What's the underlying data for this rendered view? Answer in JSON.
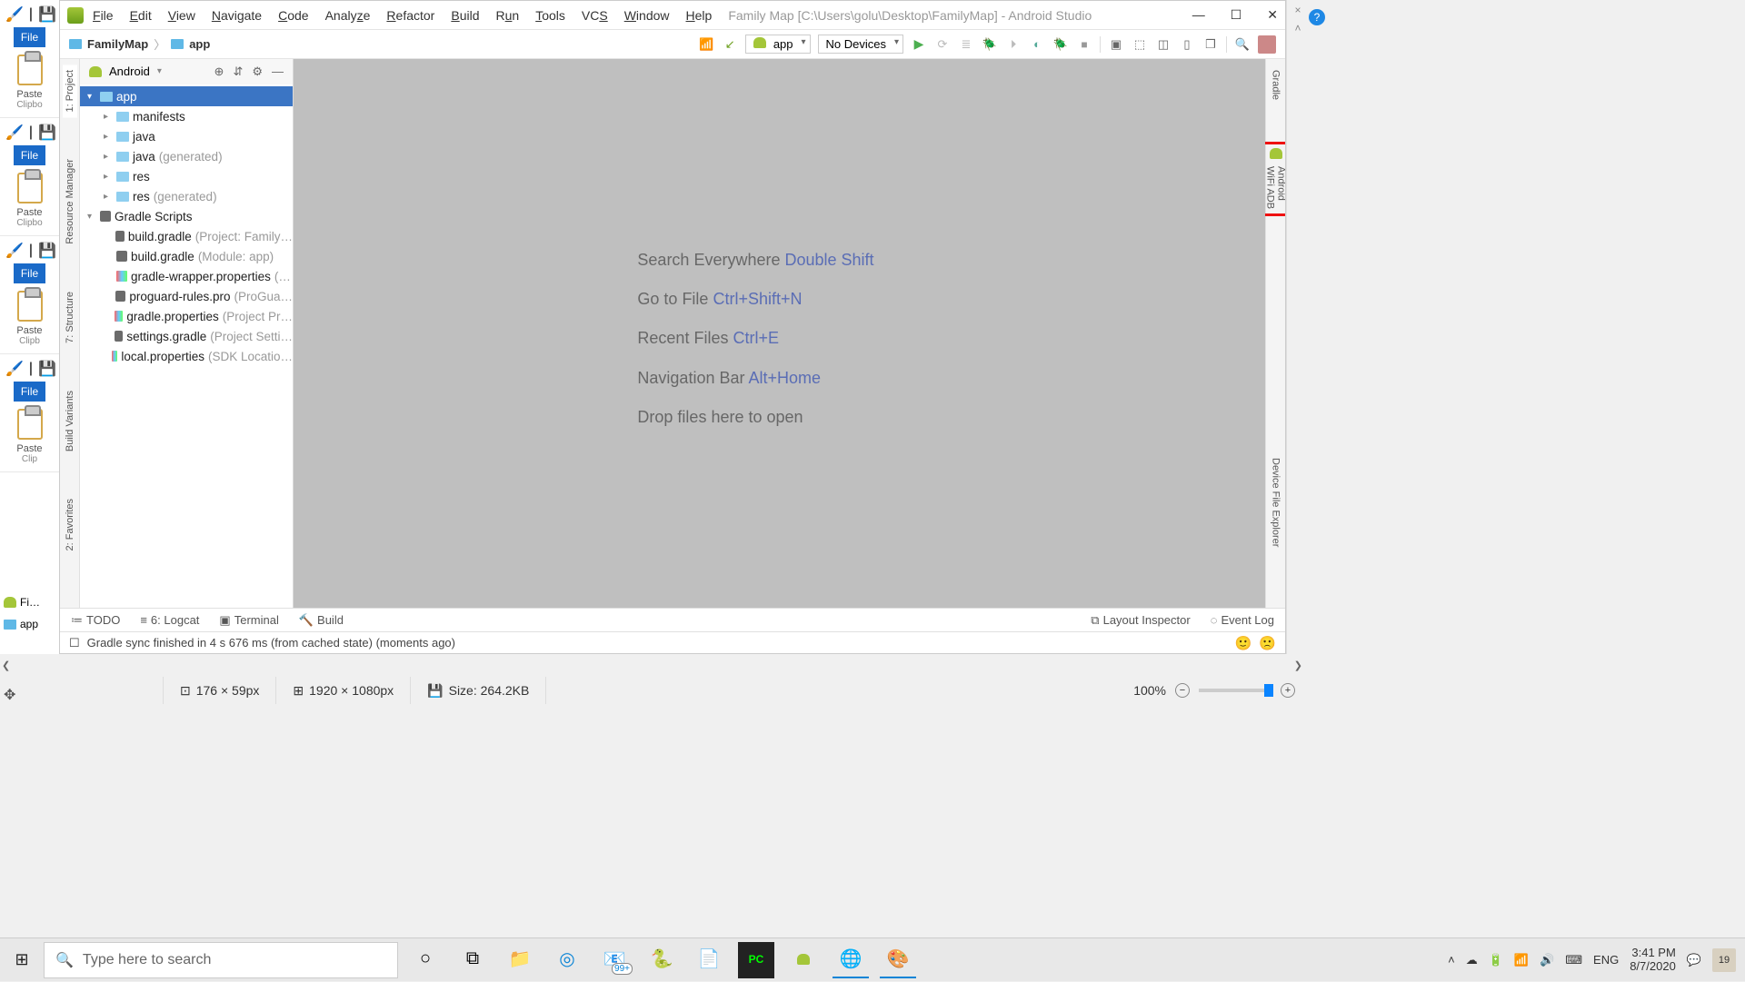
{
  "leftcards": [
    {
      "file": "File",
      "label": "Paste",
      "sub": "Clipbo"
    },
    {
      "file": "File",
      "label": "Paste",
      "sub": "Clipbo"
    },
    {
      "file": "File",
      "label": "Paste",
      "sub": "Clipb"
    },
    {
      "file": "File",
      "label": "Paste",
      "sub": "Clip"
    }
  ],
  "menu": [
    "File",
    "Edit",
    "View",
    "Navigate",
    "Code",
    "Analyze",
    "Refactor",
    "Build",
    "Run",
    "Tools",
    "VCS",
    "Window",
    "Help"
  ],
  "titlebar": {
    "title": "Family Map [C:\\Users\\golu\\Desktop\\FamilyMap] - Android Studio"
  },
  "breadcrumb": {
    "root": "FamilyMap",
    "child": "app"
  },
  "toolbar": {
    "config": "app",
    "devices": "No Devices"
  },
  "project": {
    "view": "Android",
    "tree": [
      {
        "d": 0,
        "exp": "▾",
        "icon": "folder",
        "label": "app",
        "selected": true
      },
      {
        "d": 1,
        "exp": "▸",
        "icon": "folder",
        "label": "manifests"
      },
      {
        "d": 1,
        "exp": "▸",
        "icon": "folder",
        "label": "java"
      },
      {
        "d": 1,
        "exp": "▸",
        "icon": "folder",
        "label": "java",
        "dim": "(generated)"
      },
      {
        "d": 1,
        "exp": "▸",
        "icon": "folder",
        "label": "res"
      },
      {
        "d": 1,
        "exp": "▸",
        "icon": "folder",
        "label": "res",
        "dim": "(generated)"
      },
      {
        "d": 0,
        "exp": "▾",
        "icon": "gradle",
        "label": "Gradle Scripts"
      },
      {
        "d": 1,
        "exp": "",
        "icon": "gradle",
        "label": "build.gradle",
        "dim": "(Project: Family…"
      },
      {
        "d": 1,
        "exp": "",
        "icon": "gradle",
        "label": "build.gradle",
        "dim": "(Module: app)"
      },
      {
        "d": 1,
        "exp": "",
        "icon": "prop",
        "label": "gradle-wrapper.properties",
        "dim": "(…"
      },
      {
        "d": 1,
        "exp": "",
        "icon": "gradle",
        "label": "proguard-rules.pro",
        "dim": "(ProGua…"
      },
      {
        "d": 1,
        "exp": "",
        "icon": "prop",
        "label": "gradle.properties",
        "dim": "(Project Pr…"
      },
      {
        "d": 1,
        "exp": "",
        "icon": "gradle",
        "label": "settings.gradle",
        "dim": "(Project Setti…"
      },
      {
        "d": 1,
        "exp": "",
        "icon": "prop",
        "label": "local.properties",
        "dim": "(SDK Locatio…"
      }
    ]
  },
  "leftGutter": [
    "1: Project",
    "Resource Manager",
    "7: Structure",
    "Build Variants",
    "2: Favorites"
  ],
  "rightGutter": {
    "gradle": "Gradle",
    "wifi": "Android WiFi ADB",
    "dfe": "Device File Explorer"
  },
  "hints": [
    {
      "t": "Search Everywhere ",
      "k": "Double Shift"
    },
    {
      "t": "Go to File ",
      "k": "Ctrl+Shift+N"
    },
    {
      "t": "Recent Files ",
      "k": "Ctrl+E"
    },
    {
      "t": "Navigation Bar ",
      "k": "Alt+Home"
    },
    {
      "t": "Drop files here to open",
      "k": ""
    }
  ],
  "bottomTabs": {
    "l": [
      "TODO",
      "6: Logcat",
      "Terminal",
      "Build"
    ],
    "r": [
      "Layout Inspector",
      "Event Log"
    ]
  },
  "status": {
    "msg": "Gradle sync finished in 4 s 676 ms (from cached state) (moments ago)"
  },
  "viewer": {
    "sel": "176 × 59px",
    "canvas": "1920 × 1080px",
    "size": "Size: 264.2KB",
    "zoom": "100%"
  },
  "taskbar": {
    "placeholder": "Type here to search",
    "lang": "ENG",
    "time": "3:41 PM",
    "date": "8/7/2020",
    "mail": "99+",
    "notif": "19"
  },
  "smallTabs": {
    "a": "Fi…",
    "b": "app"
  }
}
